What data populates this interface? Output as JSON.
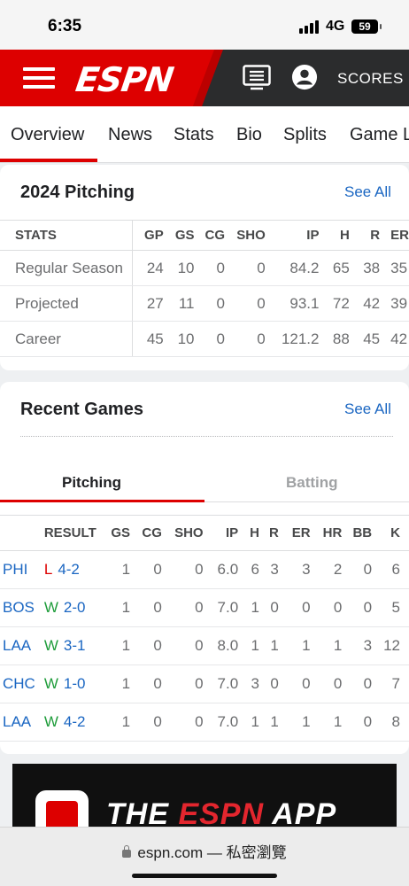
{
  "status_bar": {
    "time": "6:35",
    "network": "4G",
    "battery": "59"
  },
  "header": {
    "logo": "ESPN",
    "scores_label": "SCORES",
    "menu_icon": "hamburger-icon",
    "tv_icon": "tv-guide-icon",
    "profile_icon": "profile-icon"
  },
  "tabs": [
    "Overview",
    "News",
    "Stats",
    "Bio",
    "Splits",
    "Game L"
  ],
  "active_tab": "Overview",
  "pitching_card": {
    "title": "2024 Pitching",
    "see_all": "See All",
    "columns": [
      "STATS",
      "GP",
      "GS",
      "CG",
      "SHO",
      "IP",
      "H",
      "R",
      "ER"
    ],
    "rows": [
      {
        "label": "Regular Season",
        "values": [
          "24",
          "10",
          "0",
          "0",
          "84.2",
          "65",
          "38",
          "35"
        ]
      },
      {
        "label": "Projected",
        "values": [
          "27",
          "11",
          "0",
          "0",
          "93.1",
          "72",
          "42",
          "39"
        ]
      },
      {
        "label": "Career",
        "values": [
          "45",
          "10",
          "0",
          "0",
          "121.2",
          "88",
          "45",
          "42"
        ]
      }
    ]
  },
  "recent_games_card": {
    "title": "Recent Games",
    "see_all": "See All",
    "tabs": [
      "Pitching",
      "Batting"
    ],
    "active_tab": "Pitching",
    "columns": [
      "",
      "RESULT",
      "GS",
      "CG",
      "SHO",
      "IP",
      "H",
      "R",
      "ER",
      "HR",
      "BB",
      "K"
    ],
    "rows": [
      {
        "opp": "PHI",
        "wl": "L",
        "score": "4-2",
        "stats": [
          "1",
          "0",
          "0",
          "6.0",
          "6",
          "3",
          "3",
          "2",
          "0",
          "6"
        ]
      },
      {
        "opp": "BOS",
        "wl": "W",
        "score": "2-0",
        "stats": [
          "1",
          "0",
          "0",
          "7.0",
          "1",
          "0",
          "0",
          "0",
          "0",
          "5"
        ]
      },
      {
        "opp": "LAA",
        "wl": "W",
        "score": "3-1",
        "stats": [
          "1",
          "0",
          "0",
          "8.0",
          "1",
          "1",
          "1",
          "1",
          "3",
          "12"
        ]
      },
      {
        "opp": "CHC",
        "wl": "W",
        "score": "1-0",
        "stats": [
          "1",
          "0",
          "0",
          "7.0",
          "3",
          "0",
          "0",
          "0",
          "0",
          "7"
        ]
      },
      {
        "opp": "LAA",
        "wl": "W",
        "score": "4-2",
        "stats": [
          "1",
          "0",
          "0",
          "7.0",
          "1",
          "1",
          "1",
          "1",
          "0",
          "8"
        ]
      }
    ]
  },
  "ad": {
    "text_pre": "THE ",
    "text_brand": "ESPN",
    "text_post": " APP"
  },
  "browser": {
    "url": "espn.com",
    "mode": "— 私密瀏覽"
  },
  "colors": {
    "espn_red": "#dd0000",
    "link_blue": "#1a66c2",
    "win_green": "#1e9c3a",
    "loss_red": "#dd0000"
  }
}
